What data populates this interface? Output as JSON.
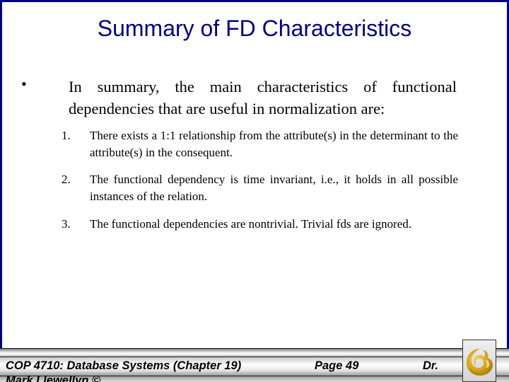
{
  "slide": {
    "title": "Summary of FD Characteristics",
    "bullet_symbol": "•",
    "intro": "In summary, the main characteristics of functional dependencies that are useful in normalization are:",
    "items": [
      {
        "number": "1.",
        "text": "There exists a 1:1 relationship from the attribute(s) in the determinant to the attribute(s) in the consequent."
      },
      {
        "number": "2.",
        "text": "The functional dependency is time invariant, i.e., it holds in all possible instances of the relation."
      },
      {
        "number": "3.",
        "text": "The functional dependencies are nontrivial.  Trivial fds are ignored."
      }
    ]
  },
  "footer": {
    "course": "COP 4710: Database Systems  (Chapter 19)",
    "page": "Page 49",
    "dr": "Dr.",
    "author": "Mark Llewellyn ©",
    "logo_icon": "pegasus-logo-icon"
  },
  "colors": {
    "title": "#000080",
    "frame": "#000080",
    "logo_gold": "#D4A017"
  }
}
